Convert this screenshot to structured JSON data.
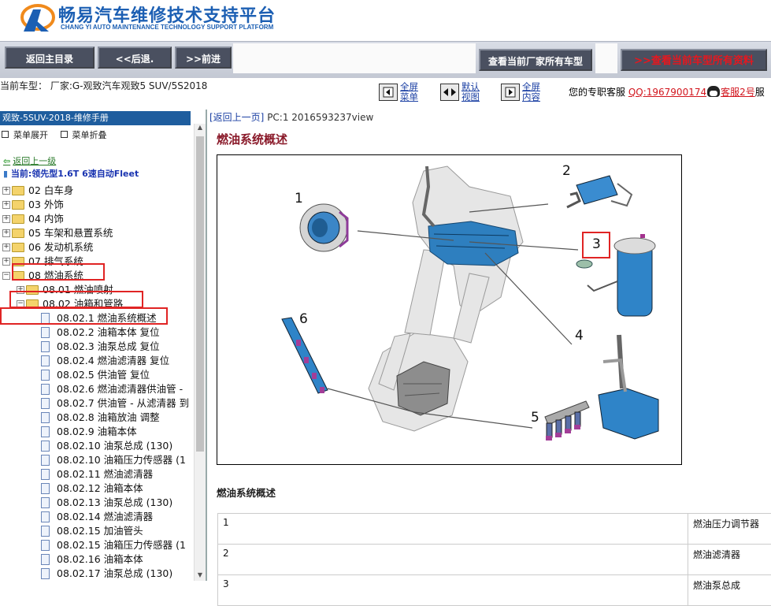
{
  "header": {
    "title_cn": "畅易汽车维修技术支持平台",
    "title_en": "CHANG YI AUTO MAINTENANCE TECHNOLOGY SUPPORT PLATFORM"
  },
  "nav": {
    "home": "返回主目录",
    "back": "<<后退.",
    "forward": ">>前进",
    "factory_models": "查看当前厂家所有车型",
    "all_data": ">>查看当前车型所有资料"
  },
  "info": {
    "vehicle": "当前车型：  厂家:G-观致汽车观致5 SUV/5S2018",
    "view_controls": [
      {
        "line1": "全屏",
        "line2": "菜单"
      },
      {
        "line1": "默认",
        "line2": "视图"
      },
      {
        "line1": "全屏",
        "line2": "内容"
      }
    ],
    "service_prefix": "您的专职客服 ",
    "qq": "QQ:1967900174",
    "service_name": "客服2号",
    "service_suffix": "服"
  },
  "tree": {
    "title": "观致-5SUV-2018-维修手册",
    "expand": "菜单展开",
    "collapse": "菜单折叠",
    "go_up": "返回上一级",
    "current": "当前:领先型1.6T 6速自动Fleet",
    "items": [
      {
        "label": "02 白车身",
        "level": 0,
        "type": "folder",
        "pm": "+"
      },
      {
        "label": "03 外饰",
        "level": 0,
        "type": "folder",
        "pm": "+"
      },
      {
        "label": "04 内饰",
        "level": 0,
        "type": "folder",
        "pm": "+"
      },
      {
        "label": "05 车架和悬置系统",
        "level": 0,
        "type": "folder",
        "pm": "+"
      },
      {
        "label": "06 发动机系统",
        "level": 0,
        "type": "folder",
        "pm": "+"
      },
      {
        "label": "07 排气系统",
        "level": 0,
        "type": "folder",
        "pm": "+"
      },
      {
        "label": "08 燃油系统",
        "level": 0,
        "type": "folder",
        "pm": "−"
      },
      {
        "label": "08.01 燃油喷射",
        "level": 1,
        "type": "folder",
        "pm": "+"
      },
      {
        "label": "08.02 油箱和管路",
        "level": 1,
        "type": "folder",
        "pm": "−"
      },
      {
        "label": "08.02.1 燃油系统概述",
        "level": 2,
        "type": "doc"
      },
      {
        "label": "08.02.2 油箱本体 复位",
        "level": 2,
        "type": "doc"
      },
      {
        "label": "08.02.3 油泵总成 复位",
        "level": 2,
        "type": "doc"
      },
      {
        "label": "08.02.4 燃油滤清器 复位",
        "level": 2,
        "type": "doc"
      },
      {
        "label": "08.02.5 供油管 复位",
        "level": 2,
        "type": "doc"
      },
      {
        "label": "08.02.6 燃油滤清器供油管 -",
        "level": 2,
        "type": "doc"
      },
      {
        "label": "08.02.7 供油管 - 从滤清器 到",
        "level": 2,
        "type": "doc"
      },
      {
        "label": "08.02.8 油箱放油 调整",
        "level": 2,
        "type": "doc"
      },
      {
        "label": "08.02.9 油箱本体",
        "level": 2,
        "type": "doc"
      },
      {
        "label": "08.02.10 油泵总成 (130)",
        "level": 2,
        "type": "doc"
      },
      {
        "label": "08.02.10 油箱压力传感器 (1",
        "level": 2,
        "type": "doc"
      },
      {
        "label": "08.02.11 燃油滤清器",
        "level": 2,
        "type": "doc"
      },
      {
        "label": "08.02.12 油箱本体",
        "level": 2,
        "type": "doc"
      },
      {
        "label": "08.02.13 油泵总成 (130)",
        "level": 2,
        "type": "doc"
      },
      {
        "label": "08.02.14 燃油滤清器",
        "level": 2,
        "type": "doc"
      },
      {
        "label": "08.02.15 加油管头",
        "level": 2,
        "type": "doc"
      },
      {
        "label": "08.02.15 油箱压力传感器 (1",
        "level": 2,
        "type": "doc"
      },
      {
        "label": "08.02.16 油箱本体",
        "level": 2,
        "type": "doc"
      },
      {
        "label": "08.02.17 油泵总成 (130)",
        "level": 2,
        "type": "doc"
      }
    ]
  },
  "content": {
    "crumb_link": "[返回上一页]",
    "crumb_text": " PC:1 2016593237view",
    "title": "燃油系统概述",
    "figure_labels": [
      "1",
      "2",
      "3",
      "4",
      "5",
      "6"
    ],
    "section_title": "燃油系统概述",
    "table": [
      {
        "num": "1",
        "name": "燃油压力调节器"
      },
      {
        "num": "2",
        "name": "燃油滤清器"
      },
      {
        "num": "3",
        "name": "燃油泵总成"
      }
    ]
  },
  "colors": {
    "brand_blue": "#1c5fb3",
    "nav_button": "#4a5060",
    "highlight_red": "#e02424",
    "title_maroon": "#8a1a2a",
    "tree_header": "#1e5d9e"
  }
}
